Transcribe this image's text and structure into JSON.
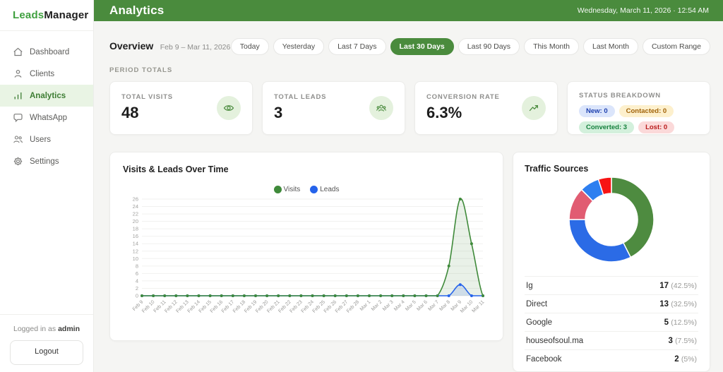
{
  "app": {
    "brand_leads": "Leads",
    "brand_manager": "Manager"
  },
  "sidebar": {
    "items": [
      {
        "label": "Dashboard",
        "icon": "home",
        "active": false
      },
      {
        "label": "Clients",
        "icon": "person",
        "active": false
      },
      {
        "label": "Analytics",
        "icon": "chart",
        "active": true
      },
      {
        "label": "WhatsApp",
        "icon": "chat",
        "active": false
      },
      {
        "label": "Users",
        "icon": "people",
        "active": false
      },
      {
        "label": "Settings",
        "icon": "gear",
        "active": false
      }
    ],
    "footer": {
      "logged_in_prefix": "Logged in as",
      "username": "admin",
      "logout_label": "Logout"
    }
  },
  "header": {
    "title": "Analytics",
    "datetime": "Wednesday, March 11, 2026 · 12:54 AM"
  },
  "overview": {
    "title": "Overview",
    "range": "Feb 9 – Mar 11, 2026",
    "section_label": "PERIOD TOTALS"
  },
  "filters": {
    "options": [
      "Today",
      "Yesterday",
      "Last 7 Days",
      "Last 30 Days",
      "Last 90 Days",
      "This Month",
      "Last Month",
      "Custom Range"
    ],
    "selected": "Last 30 Days"
  },
  "stats": {
    "visits": {
      "label": "TOTAL VISITS",
      "value": "48",
      "icon": "eye-icon"
    },
    "leads": {
      "label": "TOTAL LEADS",
      "value": "3",
      "icon": "leads-group-icon"
    },
    "conversion": {
      "label": "CONVERSION RATE",
      "value": "6.3%",
      "icon": "trending-up-icon"
    },
    "status": {
      "label": "STATUS BREAKDOWN",
      "badges": [
        {
          "text": "New: 0",
          "color": "blue"
        },
        {
          "text": "Contacted: 0",
          "color": "yellow"
        },
        {
          "text": "Converted: 3",
          "color": "green"
        },
        {
          "text": "Lost: 0",
          "color": "red"
        }
      ]
    }
  },
  "chart_data": [
    {
      "type": "line",
      "title": "Visits & Leads Over Time",
      "x": [
        "Feb 9",
        "Feb 10",
        "Feb 11",
        "Feb 12",
        "Feb 13",
        "Feb 14",
        "Feb 15",
        "Feb 16",
        "Feb 17",
        "Feb 18",
        "Feb 19",
        "Feb 20",
        "Feb 21",
        "Feb 22",
        "Feb 23",
        "Feb 24",
        "Feb 25",
        "Feb 26",
        "Feb 27",
        "Feb 28",
        "Mar 1",
        "Mar 2",
        "Mar 3",
        "Mar 4",
        "Mar 5",
        "Mar 6",
        "Mar 7",
        "Mar 8",
        "Mar 9",
        "Mar 10",
        "Mar 11"
      ],
      "series": [
        {
          "name": "Visits",
          "color": "#3f8a3a",
          "fill": "rgba(76,139,62,0.12)",
          "values": [
            0,
            0,
            0,
            0,
            0,
            0,
            0,
            0,
            0,
            0,
            0,
            0,
            0,
            0,
            0,
            0,
            0,
            0,
            0,
            0,
            0,
            0,
            0,
            0,
            0,
            0,
            0,
            8,
            26,
            14,
            0
          ]
        },
        {
          "name": "Leads",
          "color": "#2563eb",
          "fill": "rgba(59,110,235,0.15)",
          "values": [
            0,
            0,
            0,
            0,
            0,
            0,
            0,
            0,
            0,
            0,
            0,
            0,
            0,
            0,
            0,
            0,
            0,
            0,
            0,
            0,
            0,
            0,
            0,
            0,
            0,
            0,
            0,
            0,
            3,
            0,
            0
          ]
        }
      ],
      "ylim": [
        0,
        26
      ],
      "ytick_step": 2,
      "grid": true,
      "legend_position": "top"
    },
    {
      "type": "pie",
      "title": "Traffic Sources",
      "donut": true,
      "slices": [
        {
          "label": "Ig",
          "value": 17,
          "pct": "42.5%",
          "color": "#4e8b40"
        },
        {
          "label": "Direct",
          "value": 13,
          "pct": "32.5%",
          "color": "#2b6be6"
        },
        {
          "label": "Google",
          "value": 5,
          "pct": "12.5%",
          "color": "#e15c72"
        },
        {
          "label": "houseofsoul.ma",
          "value": 3,
          "pct": "7.5%",
          "color": "#2e7ff0"
        },
        {
          "label": "Facebook",
          "value": 2,
          "pct": "5%",
          "color": "#f71414"
        }
      ]
    }
  ]
}
